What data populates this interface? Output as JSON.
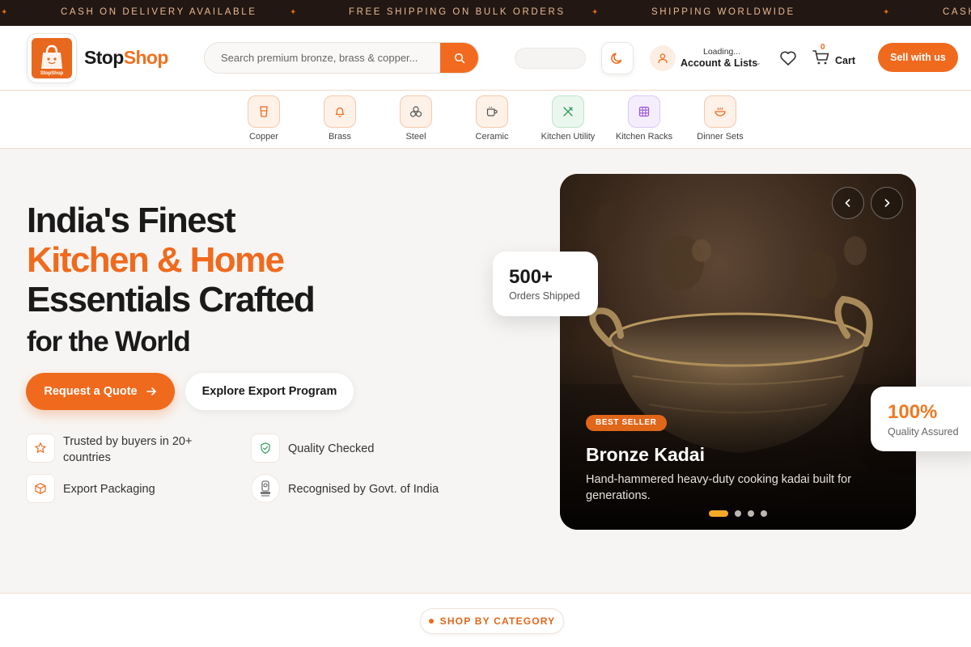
{
  "ticker": {
    "items": [
      "CASH ON DELIVERY AVAILABLE",
      "FREE SHIPPING ON BULK ORDERS",
      "SHIPPING WORLDWIDE",
      "CASH"
    ],
    "separator_icon": "sparkle-icon"
  },
  "header": {
    "logo_text": "StopShop",
    "brand_part1": "Stop",
    "brand_part2": "Shop",
    "search_placeholder": "Search premium bronze, brass & copper...",
    "search_icon": "search-icon",
    "theme_icon": "moon-icon",
    "account_status": "Loading...",
    "account_label": "Account & Lists",
    "wishlist_icon": "heart-icon",
    "cart_count": "0",
    "cart_label": "Cart",
    "sell_label": "Sell with us"
  },
  "categories": [
    {
      "label": "Copper",
      "icon": "cup-icon"
    },
    {
      "label": "Brass",
      "icon": "bell-icon"
    },
    {
      "label": "Steel",
      "icon": "vessels-icon"
    },
    {
      "label": "Ceramic",
      "icon": "mug-icon"
    },
    {
      "label": "Kitchen Utility",
      "icon": "utensils-icon"
    },
    {
      "label": "Kitchen Racks",
      "icon": "grid-icon"
    },
    {
      "label": "Dinner Sets",
      "icon": "bowl-icon"
    }
  ],
  "hero": {
    "line1": "India's Finest",
    "line2": "Kitchen & Home",
    "line3": "Essentials Crafted",
    "line4": "for the World",
    "cta_primary": "Request a Quote",
    "cta_secondary": "Explore Export Program",
    "features": [
      {
        "label": "Trusted by buyers in 20+ countries",
        "icon": "star-icon"
      },
      {
        "label": "Quality Checked",
        "icon": "shield-check-icon"
      },
      {
        "label": "Export Packaging",
        "icon": "package-icon"
      },
      {
        "label": "Recognised by Govt. of India",
        "icon": "emblem-icon"
      }
    ]
  },
  "slide": {
    "badge": "BEST SELLER",
    "title": "Bronze Kadai",
    "description": "Hand-hammered heavy-duty cooking kadai built for generations.",
    "total_slides": 4,
    "active_slide": 1
  },
  "stats": {
    "orders_value": "500+",
    "orders_label": "Orders Shipped",
    "quality_value": "100%",
    "quality_label": "Quality Assured"
  },
  "section": {
    "shop_by_category": "SHOP BY CATEGORY"
  },
  "colors": {
    "accent": "#f06a1e",
    "dark_bar": "#221712",
    "slide_dot_active": "#f4a827"
  }
}
